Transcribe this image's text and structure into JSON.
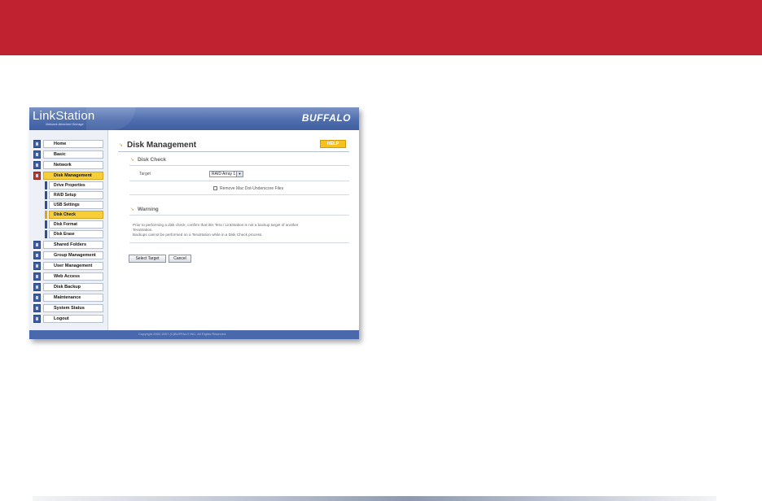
{
  "app": {
    "logo_text": "LinkStation",
    "logo_tagline": "Network Attached Storage",
    "brand": "BUFFALO"
  },
  "nav": {
    "items": [
      {
        "label": "Home"
      },
      {
        "label": "Basic"
      },
      {
        "label": "Network"
      },
      {
        "label": "Disk Management",
        "active": true
      },
      {
        "label": "Shared Folders"
      },
      {
        "label": "Group Management"
      },
      {
        "label": "User Management"
      },
      {
        "label": "Web Access"
      },
      {
        "label": "Disk Backup"
      },
      {
        "label": "Maintenance"
      },
      {
        "label": "System Status"
      },
      {
        "label": "Logout"
      }
    ],
    "sub_items": [
      {
        "label": "Drive Properties"
      },
      {
        "label": "RAID Setup"
      },
      {
        "label": "USB Settings"
      },
      {
        "label": "Disk Check",
        "active": true
      },
      {
        "label": "Disk Format"
      },
      {
        "label": "Disk Erase"
      }
    ]
  },
  "page": {
    "title": "Disk Management",
    "help_label": "HELP",
    "disk_check": {
      "section_title": "Disk Check",
      "target_label": "Target",
      "target_value": "RAID Array 1",
      "checkbox_label": "Remove Mac Dot-Underscore Files"
    },
    "warning": {
      "section_title": "Warning",
      "line1": "Prior to performing a disk check, confirm that this Tera / LinkStation is not a backup target of another",
      "line2": "TeraStation.",
      "line3": "Backups cannot be performed on a TeraStation while in a Disk Check process."
    },
    "buttons": {
      "select_target": "Select Target",
      "cancel": "Cancel"
    }
  },
  "footer": {
    "copyright": "Copyright 2002-2007 (C)BUFFALO INC. All Rights Reserved."
  },
  "colors": {
    "banner_red": "#c0232f",
    "header_blue": "#4f6eae",
    "active_yellow": "#f6cf38",
    "help_orange": "#f6c11d"
  }
}
